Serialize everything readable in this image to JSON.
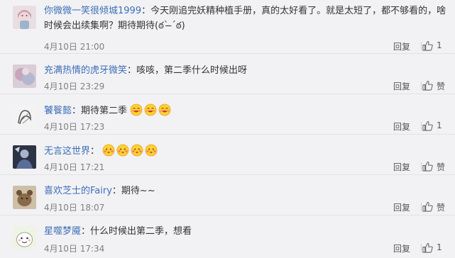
{
  "comments": [
    {
      "user": "你微微一笑很倾城1999",
      "text_line1": "：今天刚追完妖精种植手册，真的太好看了。就是太短了，都不够看的，啥",
      "text_line2": "时候会出续集啊？期待期待(ఠ` ̶´ఠ)",
      "time": "4月10日 21:00",
      "reply_label": "回复",
      "like_label": "1",
      "avatar_icon": "user-avatar-anime-girl"
    },
    {
      "user": "充满热情的虎牙微笑",
      "text": "：咳咳，第二季什么时候出呀",
      "time": "4月10日 23:29",
      "reply_label": "回复",
      "like_label": "赞",
      "avatar_icon": "user-avatar-blurred"
    },
    {
      "user": "饕餮懿",
      "text": "：期待第二季",
      "emojis": [
        "happy-emoji",
        "happy-emoji",
        "happy-emoji"
      ],
      "time": "4月10日 17:23",
      "reply_label": "回复",
      "like_label": "1",
      "avatar_icon": "user-avatar-sketch"
    },
    {
      "user": "无言这世界",
      "text": "：",
      "emojis": [
        "shy-emoji",
        "shy-emoji",
        "shy-emoji",
        "shy-emoji"
      ],
      "time": "4月10日 17:21",
      "reply_label": "回复",
      "like_label": "赞",
      "avatar_icon": "user-avatar-dark"
    },
    {
      "user": "喜欢芝士的Fairy",
      "text": "：期待~~",
      "time": "4月10日 18:07",
      "reply_label": "回复",
      "like_label": "赞",
      "avatar_icon": "user-avatar-animal"
    },
    {
      "user": "星噬梦魇",
      "text": "：什么时候出第二季，想看",
      "time": "4月10日 17:34",
      "reply_label": "回复",
      "like_label": "1",
      "avatar_icon": "user-avatar-cartoon"
    }
  ],
  "colors": {
    "username": "#3d6fb6",
    "text": "#333333",
    "meta": "#808080",
    "background": "#f2f2f5"
  }
}
